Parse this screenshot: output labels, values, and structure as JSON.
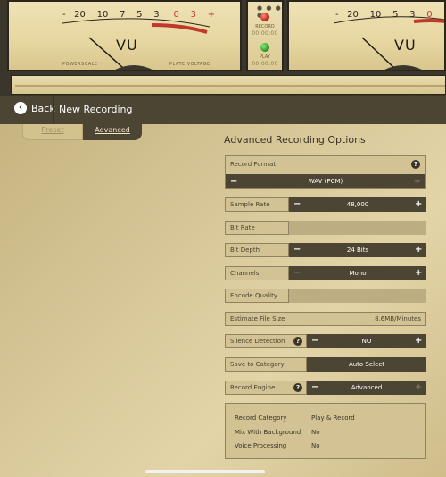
{
  "left_meter": {
    "scale": [
      "-",
      "20",
      "10",
      "7",
      "5",
      "3",
      "0",
      "3",
      "+"
    ],
    "vu_label": "VU",
    "foot_left": "POWERSCALE",
    "foot_right": "PLATE VOLTAGE"
  },
  "right_meter": {
    "scale": [
      "-",
      "20",
      "10",
      "5",
      "3",
      "0"
    ],
    "vu_label": "VU"
  },
  "center_panel": {
    "page_dots": "● ● ● ●",
    "record_label": "RECORD",
    "record_time": "00:00:00",
    "play_label": "PLAY",
    "play_time": "00:00:00"
  },
  "nav": {
    "back_label": "Back",
    "title": "New Recording"
  },
  "tabs": {
    "preset": "Preset",
    "advanced": "Advanced"
  },
  "page_title": "Advanced Recording Options",
  "record_format": {
    "label": "Record Format",
    "value": "WAV (PCM)"
  },
  "sample_rate": {
    "label": "Sample Rate",
    "value": "48,000"
  },
  "bit_rate": {
    "label": "Bit Rate"
  },
  "bit_depth": {
    "label": "Bit Depth",
    "value": "24 Bits"
  },
  "channels": {
    "label": "Channels",
    "value": "Mono"
  },
  "encode_quality": {
    "label": "Encode Quality"
  },
  "estimate_file_size": {
    "label": "Estimate File Size",
    "value": "8.6MB/Minutes"
  },
  "silence_detection": {
    "label": "Silence Detection",
    "value": "NO"
  },
  "save_to_category": {
    "label": "Save to Category",
    "value": "Auto Select"
  },
  "record_engine": {
    "label": "Record Engine",
    "value": "Advanced"
  },
  "info": {
    "rows": [
      {
        "k": "Record Category",
        "v": "Play & Record"
      },
      {
        "k": "Mix With Background",
        "v": "No"
      },
      {
        "k": "Voice Processing",
        "v": "No"
      }
    ]
  },
  "icons": {
    "plus": "+",
    "minus": "−",
    "help": "?",
    "back": "‹"
  },
  "colors": {
    "panel_dark": "#4c4533",
    "accent_red": "#c0392b",
    "led_red": "#b11d10",
    "led_green": "#1f8c1a"
  }
}
